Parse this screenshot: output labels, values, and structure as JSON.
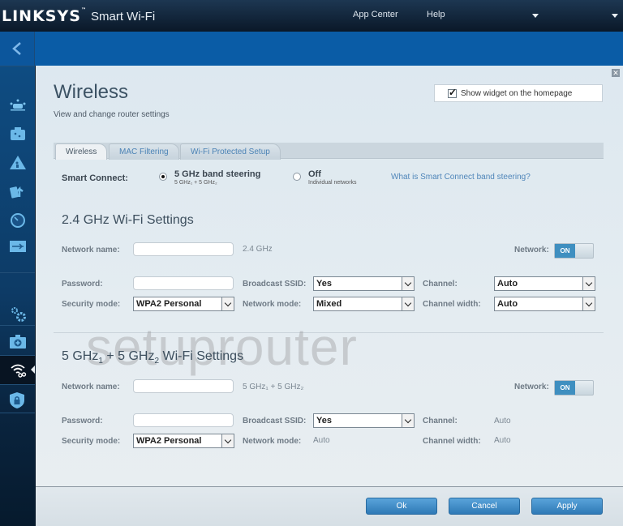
{
  "header": {
    "brand": "LINKSYS",
    "trademark": "™",
    "product": "Smart Wi-Fi",
    "nav": [
      "App Center",
      "Help"
    ]
  },
  "sidebar": {
    "items": [
      {
        "name": "device-list",
        "icon": "devices-icon"
      },
      {
        "name": "guest-access",
        "icon": "guest-access-icon"
      },
      {
        "name": "parental-controls",
        "icon": "parental-controls-icon"
      },
      {
        "name": "media-prioritization",
        "icon": "media-prioritization-icon"
      },
      {
        "name": "speed-test",
        "icon": "speedometer-icon"
      },
      {
        "name": "external-storage",
        "icon": "usb-icon"
      },
      {
        "name": "connectivity",
        "icon": "gears-icon"
      },
      {
        "name": "troubleshooting",
        "icon": "first-aid-icon"
      },
      {
        "name": "wireless",
        "icon": "wifi-gear-icon",
        "active": true
      },
      {
        "name": "security",
        "icon": "shield-lock-icon"
      }
    ]
  },
  "page": {
    "title": "Wireless",
    "subtitle": "View and change router settings",
    "widget_label": "Show widget on the homepage",
    "widget_checked": true,
    "tabs": [
      {
        "label": "Wireless",
        "active": true
      },
      {
        "label": "MAC Filtering",
        "active": false
      },
      {
        "label": "Wi-Fi Protected Setup",
        "active": false
      }
    ]
  },
  "smart_connect": {
    "label": "Smart Connect:",
    "option1": "5 GHz band steering",
    "option1_sub": "5 GHz₁ + 5 GHz₂",
    "option1_selected": true,
    "option2": "Off",
    "option2_sub": "Individual networks",
    "help_link": "What is Smart Connect band steering?"
  },
  "band24": {
    "heading": "2.4 GHz Wi-Fi Settings",
    "network_name_label": "Network name:",
    "network_name_value": "",
    "network_name_hint": "2.4 GHz",
    "network_label": "Network:",
    "network_state": "ON",
    "password_label": "Password:",
    "password_value": "",
    "broadcast_label": "Broadcast SSID:",
    "broadcast_value": "Yes",
    "channel_label": "Channel:",
    "channel_value": "Auto",
    "security_label": "Security mode:",
    "security_value": "WPA2 Personal",
    "mode_label": "Network mode:",
    "mode_value": "Mixed",
    "width_label": "Channel width:",
    "width_value": "Auto"
  },
  "band5": {
    "heading_a": "5 GHz",
    "sub1": "1",
    "heading_b": " + 5 GHz",
    "sub2": "2",
    "heading_c": " Wi-Fi Settings",
    "network_name_label": "Network name:",
    "network_name_value": "",
    "network_name_hint": "5 GHz₁ + 5 GHz₂",
    "network_label": "Network:",
    "network_state": "ON",
    "password_label": "Password:",
    "password_value": "",
    "broadcast_label": "Broadcast SSID:",
    "broadcast_value": "Yes",
    "channel_label": "Channel:",
    "channel_value": "Auto",
    "security_label": "Security mode:",
    "security_value": "WPA2 Personal",
    "mode_label": "Network mode:",
    "mode_value": "Auto",
    "width_label": "Channel width:",
    "width_value": "Auto"
  },
  "watermark": "setuprouter",
  "footer": {
    "ok": "Ok",
    "cancel": "Cancel",
    "apply": "Apply"
  }
}
